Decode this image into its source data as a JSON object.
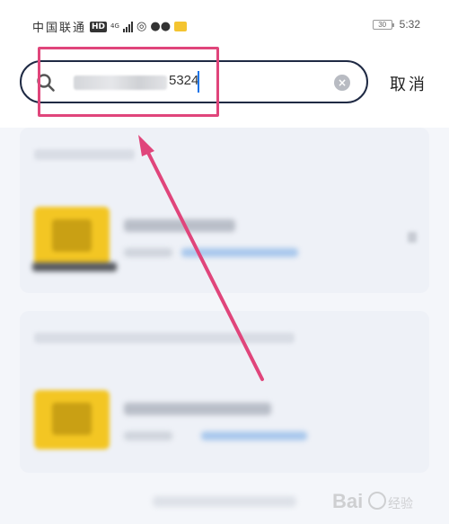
{
  "status_bar": {
    "carrier": "中国联通",
    "network_hd": "HD",
    "network_gen": "4G",
    "battery_level": "30",
    "time": "5:32"
  },
  "search": {
    "value_visible_suffix": "5324",
    "cancel_label": "取消"
  },
  "colors": {
    "highlight": "#e0457b",
    "caret": "#1a73e8",
    "search_border": "#1f2a44"
  },
  "watermark": {
    "text": "Bai 经验"
  }
}
